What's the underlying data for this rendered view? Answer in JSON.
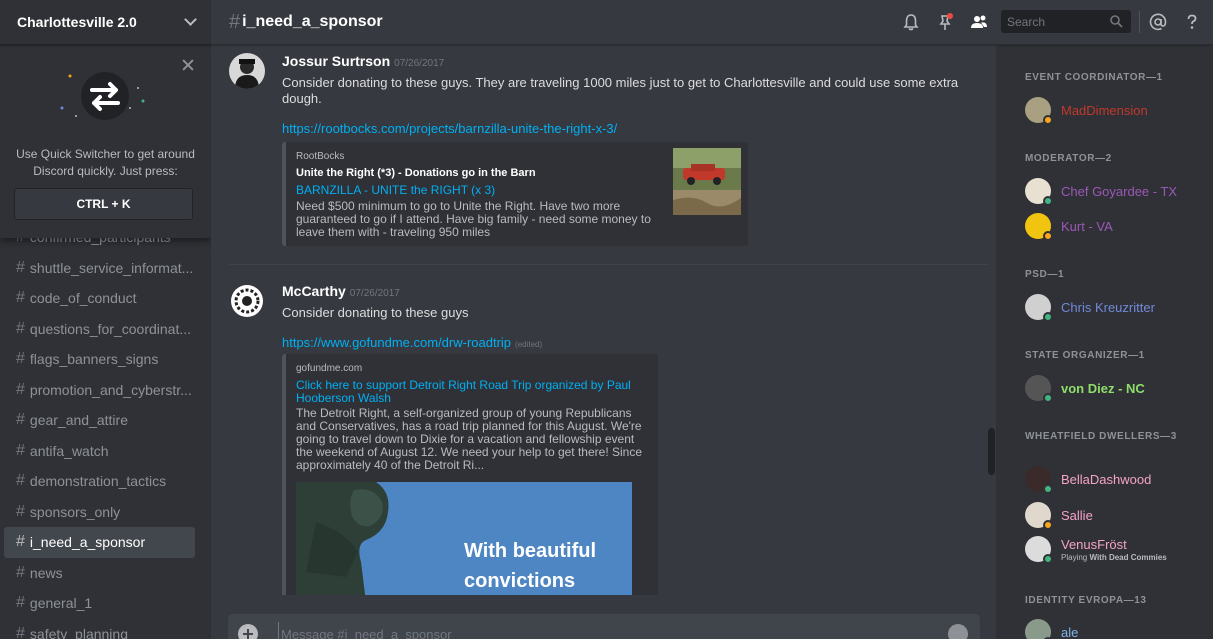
{
  "server": {
    "name": "Charlottesville 2.0"
  },
  "quick_switcher": {
    "text": "Use Quick Switcher to get around Discord quickly. Just press:",
    "shortcut": "CTRL + K"
  },
  "channels": [
    {
      "name": "confirmed_participants"
    },
    {
      "name": "shuttle_service_informat..."
    },
    {
      "name": "code_of_conduct"
    },
    {
      "name": "questions_for_coordinat..."
    },
    {
      "name": "flags_banners_signs"
    },
    {
      "name": "promotion_and_cyberstr..."
    },
    {
      "name": "gear_and_attire"
    },
    {
      "name": "antifa_watch"
    },
    {
      "name": "demonstration_tactics"
    },
    {
      "name": "sponsors_only"
    },
    {
      "name": "i_need_a_sponsor"
    },
    {
      "name": "news"
    },
    {
      "name": "general_1"
    },
    {
      "name": "safety_planning"
    }
  ],
  "channel_header": {
    "hash": "#",
    "title": "i_need_a_sponsor"
  },
  "search": {
    "placeholder": "Search"
  },
  "messages": [
    {
      "author": "Jossur Surtrson",
      "timestamp": "07/26/2017",
      "text": "Consider donating to these guys. They are traveling 1000 miles just to get to Charlottesville and could use some extra dough.",
      "link": "https://rootbocks.com/projects/barnzilla-unite-the-right-x-3/",
      "embed": {
        "provider": "RootBocks",
        "author": "Unite the Right (*3) - Donations go in the Barn",
        "title": "BARNZILLA - UNITE the RIGHT (x 3)",
        "description": "Need $500 minimum to go to Unite the Right. Have two more guaranteed to go if I attend. Have big family - need some money to leave them with - traveling 950 miles"
      }
    },
    {
      "author": "McCarthy",
      "timestamp": "07/26/2017",
      "text": "Consider donating to these guys",
      "link": "https://www.gofundme.com/drw-roadtrip",
      "edited": "(edited)",
      "embed": {
        "provider": "gofundme.com",
        "title": "Click here to support Detroit Right Road Trip organized by Paul Hooberson Walsh",
        "description": "The Detroit Right, a self-organized group of young Republicans and Conservatives, has a road trip planned for this August. We're going to travel down to Dixie for a vacation and fellowship event the weekend of August 12. We need your help to get there! Since approximately 40 of the Detroit Ri...",
        "image_caption": [
          "With beautiful",
          "convictions"
        ]
      }
    }
  ],
  "composer": {
    "placeholder": "Message #i_need_a_sponsor"
  },
  "members": {
    "roles": [
      {
        "header": "EVENT COORDINATOR—1",
        "members": [
          {
            "name": "MadDimension",
            "color": "#c0392b",
            "status": "#faa61a"
          }
        ]
      },
      {
        "header": "MODERATOR—2",
        "members": [
          {
            "name": "Chef Goyardee - TX",
            "color": "#9b59b6",
            "status": "#43b581"
          },
          {
            "name": "Kurt - VA",
            "color": "#9b59b6",
            "status": "#faa61a"
          }
        ]
      },
      {
        "header": "PSD—1",
        "members": [
          {
            "name": "Chris Kreuzritter",
            "color": "#7289da",
            "status": "#43b581"
          }
        ]
      },
      {
        "header": "STATE ORGANIZER—1",
        "members": [
          {
            "name": "von Diez - NC",
            "color": "#8fdd6a",
            "status": "#43b581"
          }
        ]
      },
      {
        "header": "WHEATFIELD DWELLERS—3",
        "members": [
          {
            "name": "BellaDashwood",
            "color": "#f4a3c8",
            "status": "#43b581"
          },
          {
            "name": "Sallie",
            "color": "#f4a3c8",
            "status": "#faa61a"
          },
          {
            "name": "VenusFröst",
            "color": "#f4a3c8",
            "status": "#43b581",
            "activity_prefix": "Playing ",
            "activity_game": "With Dead Commies"
          }
        ]
      },
      {
        "header": "IDENTITY EVROPA—13",
        "members": [
          {
            "name": "ale",
            "color": "#7fb3e6",
            "status": "#43b581"
          }
        ]
      }
    ]
  }
}
